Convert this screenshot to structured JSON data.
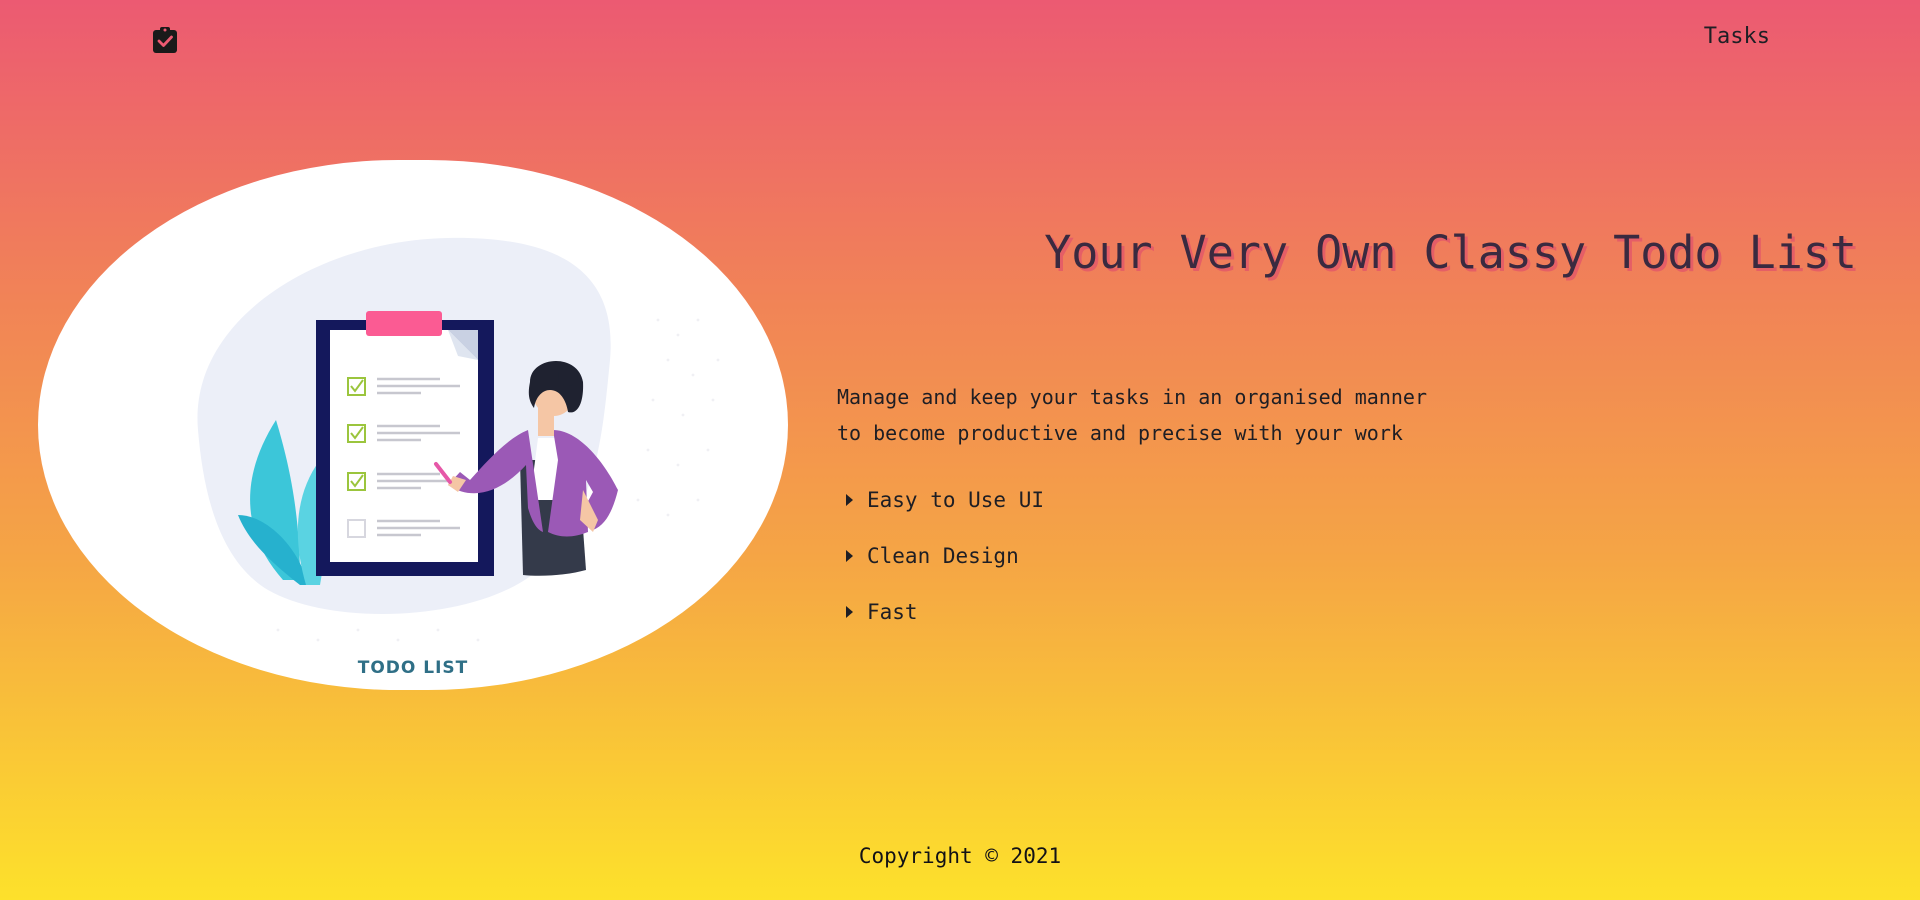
{
  "nav": {
    "logo_icon": "clipboard-check-icon",
    "tasks_link": "Tasks"
  },
  "hero": {
    "illustration": "woman-with-checklist-clipboard",
    "caption": "TODO LIST"
  },
  "headline": "Your Very Own Classy Todo List",
  "description": {
    "line1": "Manage and keep your tasks in an organised manner",
    "line2": "to become productive and precise with your work"
  },
  "features": [
    {
      "label": "Easy to Use UI",
      "icon": "caret-right-icon"
    },
    {
      "label": "Clean Design",
      "icon": "caret-right-icon"
    },
    {
      "label": "Fast",
      "icon": "caret-right-icon"
    }
  ],
  "footer": {
    "copyright": "Copyright © 2021"
  },
  "colors": {
    "gradient_top": "#ec5a72",
    "gradient_mid": "#f5a545",
    "gradient_bottom": "#fde12b",
    "headline_shadow": "#dd4a6e",
    "caption": "#2f6f86"
  }
}
